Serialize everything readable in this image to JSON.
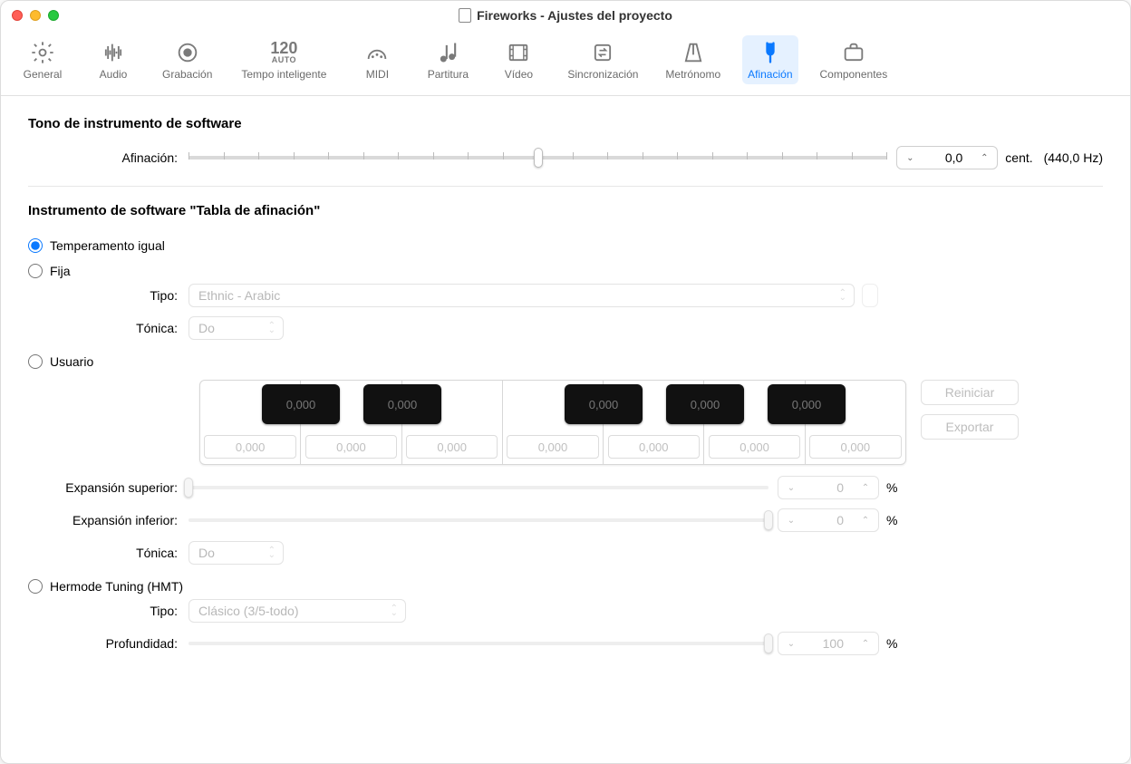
{
  "window": {
    "title": "Fireworks - Ajustes del proyecto"
  },
  "toolbar": [
    {
      "label": "General"
    },
    {
      "label": "Audio"
    },
    {
      "label": "Grabación"
    },
    {
      "label": "Tempo inteligente",
      "special_top": "120",
      "special_bottom": "AUTO"
    },
    {
      "label": "MIDI"
    },
    {
      "label": "Partitura"
    },
    {
      "label": "Vídeo"
    },
    {
      "label": "Sincronización"
    },
    {
      "label": "Metrónomo"
    },
    {
      "label": "Afinación",
      "active": true
    },
    {
      "label": "Componentes"
    }
  ],
  "section1": {
    "heading": "Tono de instrumento de software",
    "tune_label": "Afinación:",
    "tune_value": "0,0",
    "tune_unit": "cent.",
    "tune_freq": "(440,0 Hz)"
  },
  "section2": {
    "heading": "Instrumento de software \"Tabla de afinación\"",
    "r_equal": "Temperamento igual",
    "r_fixed": "Fija",
    "type_label": "Tipo:",
    "type_value": "Ethnic - Arabic",
    "tonic_label": "Tónica:",
    "tonic_value": "Do",
    "r_user": "Usuario",
    "piano": {
      "blacks": [
        "0,000",
        "0,000",
        "0,000",
        "0,000",
        "0,000"
      ],
      "whites": [
        "0,000",
        "0,000",
        "0,000",
        "0,000",
        "0,000",
        "0,000",
        "0,000"
      ]
    },
    "btn_reset": "Reiniciar",
    "btn_export": "Exportar",
    "exp_upper_label": "Expansión superior:",
    "exp_upper_value": "0",
    "exp_lower_label": "Expansión inferior:",
    "exp_lower_value": "0",
    "percent": "%",
    "tonic2_label": "Tónica:",
    "tonic2_value": "Do",
    "r_hermode": "Hermode Tuning (HMT)",
    "hm_type_label": "Tipo:",
    "hm_type_value": "Clásico (3/5-todo)",
    "depth_label": "Profundidad:",
    "depth_value": "100"
  }
}
